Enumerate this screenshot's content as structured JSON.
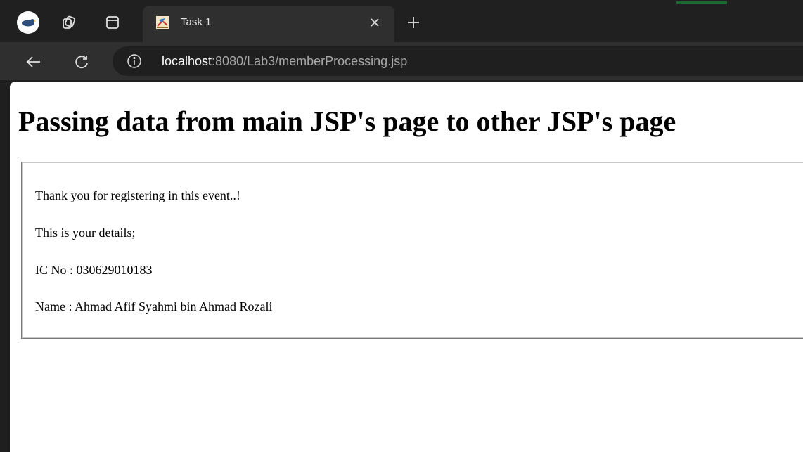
{
  "browser": {
    "tab": {
      "title": "Task 1"
    },
    "address_bar": {
      "host": "localhost",
      "path": ":8080/Lab3/memberProcessing.jsp"
    },
    "icons": {
      "profile": "profile-avatar-icon",
      "workspaces": "workspaces-icon",
      "tab_actions": "tab-actions-icon",
      "favicon": "java-cup-favicon-icon",
      "close_tab": "close-icon",
      "new_tab": "plus-icon",
      "back": "back-arrow-icon",
      "reload": "reload-icon",
      "site_info": "info-icon"
    },
    "colors": {
      "tabstrip_bg": "#202020",
      "toolbar_bg": "#2f2f2f",
      "omnibox_bg": "#1f1f1f",
      "url_host": "#ffffff",
      "url_path": "#a8a8a8"
    }
  },
  "page": {
    "heading": "Passing data from main JSP's page to other JSP's page",
    "lines": [
      "Thank you for registering in this event..!",
      "This is your details;",
      "IC No : 030629010183",
      "Name : Ahmad Afif Syahmi bin Ahmad Rozali"
    ]
  }
}
